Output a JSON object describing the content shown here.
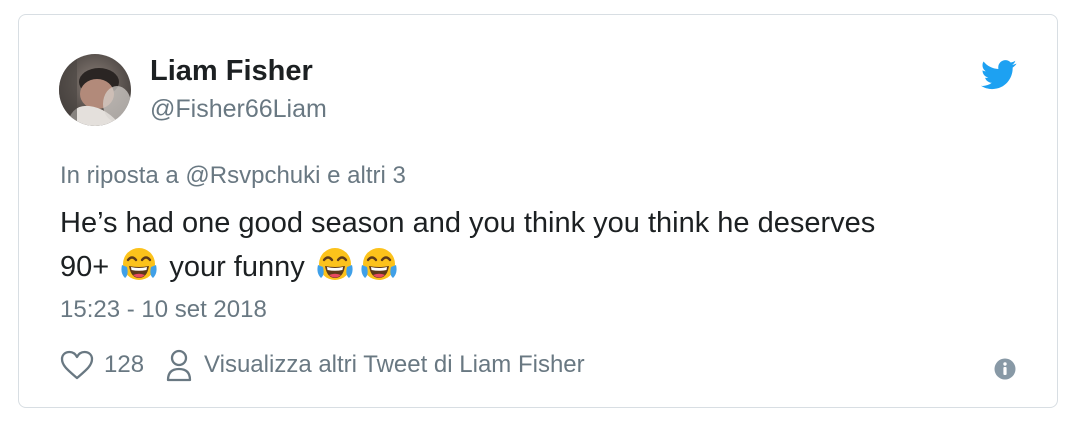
{
  "author": {
    "name": "Liam Fisher",
    "handle": "@Fisher66Liam",
    "avatar_icon": "user-photo"
  },
  "brand": {
    "logo_icon": "twitter-bird-icon",
    "color": "#1da1f2"
  },
  "tweet": {
    "reply_prefix": "In riposta a",
    "reply_mention": "@Rsvpchuki",
    "reply_suffix": "e altri 3",
    "text_line1": "He’s had one good season and you think you think he deserves",
    "text_line2_a": "90+",
    "text_line2_b": "your funny",
    "emoji_name": "face-with-tears-of-joy",
    "timestamp": "15:23 - 10 set 2018"
  },
  "actions": {
    "like_icon": "heart-icon",
    "like_count": "128",
    "profile_icon": "person-icon",
    "profile_link_label": "Visualizza altri Tweet di Liam Fisher",
    "info_icon": "info-icon"
  },
  "colors": {
    "text_primary": "#1c2022",
    "text_secondary": "#697882",
    "border": "#d8dee3"
  }
}
